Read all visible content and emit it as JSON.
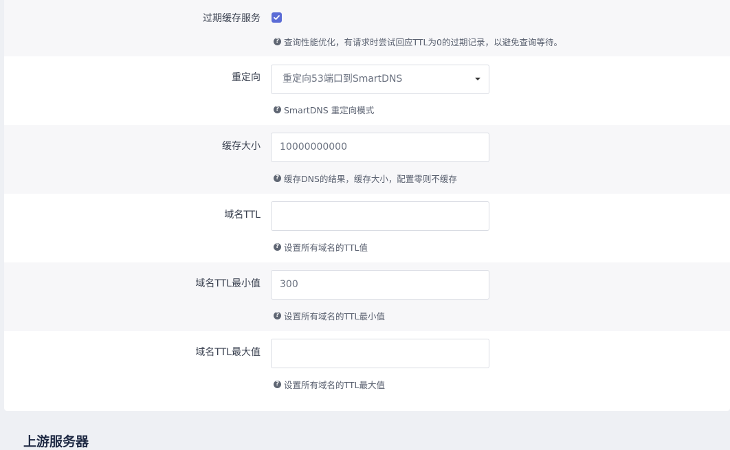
{
  "fields": {
    "expired_cache": {
      "label": "过期缓存服务",
      "checked": true,
      "description": "查询性能优化，有请求时尝试回应TTL为0的过期记录，以避免查询等待。"
    },
    "redirect": {
      "label": "重定向",
      "value": "重定向53端口到SmartDNS",
      "description": "SmartDNS 重定向模式"
    },
    "cache_size": {
      "label": "缓存大小",
      "value": "10000000000",
      "description": "缓存DNS的结果，缓存大小，配置零则不缓存"
    },
    "domain_ttl": {
      "label": "域名TTL",
      "value": "",
      "description": "设置所有域名的TTL值"
    },
    "domain_ttl_min": {
      "label": "域名TTL最小值",
      "value": "300",
      "description": "设置所有域名的TTL最小值"
    },
    "domain_ttl_max": {
      "label": "域名TTL最大值",
      "value": "",
      "description": "设置所有域名的TTL最大值"
    }
  },
  "next_section": {
    "title": "上游服务器"
  },
  "icons": {
    "help": "question-circle-icon",
    "check": "checkmark-icon",
    "caret": "caret-down-icon"
  },
  "colors": {
    "accent": "#5b6cd6"
  }
}
